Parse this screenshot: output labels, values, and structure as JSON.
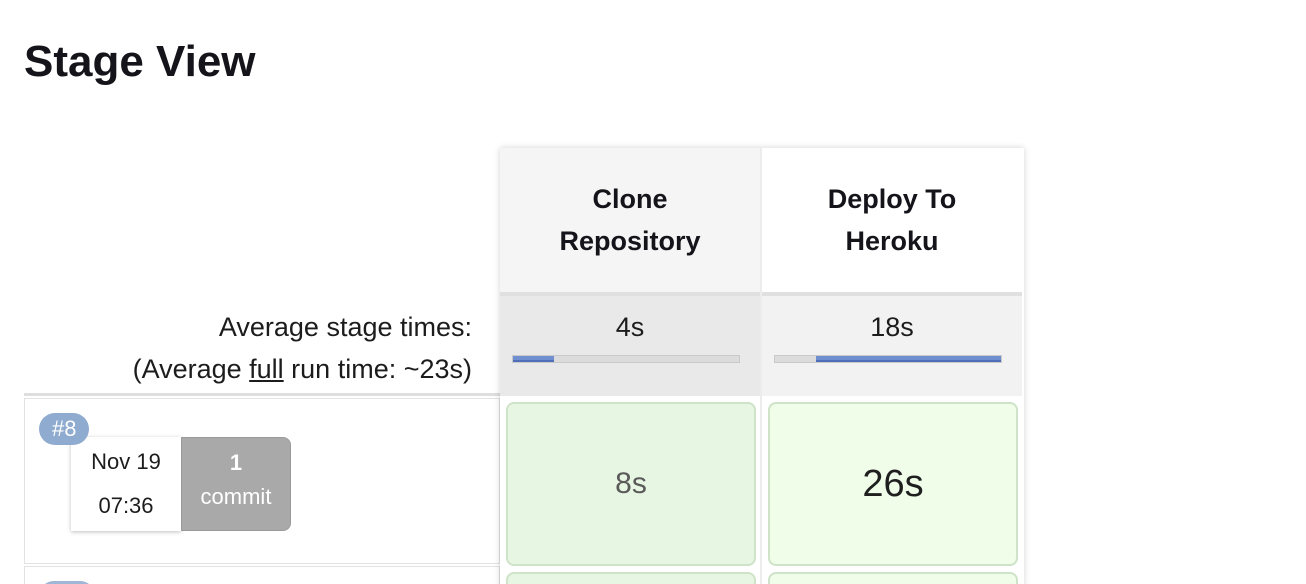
{
  "page": {
    "title": "Stage View"
  },
  "summary": {
    "avg_label": "Average stage times:",
    "avg_full_prefix": "(Average ",
    "avg_full_link": "full",
    "avg_full_suffix": " run time: ~23s)"
  },
  "stages": [
    {
      "name_line1": "Clone",
      "name_line2": "Repository",
      "avg_time": "4s",
      "avg_fraction": 0.18,
      "avg_offset_fraction": 0.0,
      "run_time": "8s"
    },
    {
      "name_line1": "Deploy To",
      "name_line2": "Heroku",
      "avg_time": "18s",
      "avg_fraction": 0.82,
      "avg_offset_fraction": 0.18,
      "run_time": "26s"
    }
  ],
  "runs": [
    {
      "build": "#8",
      "date": "Nov 19",
      "time": "07:36",
      "commit_count": "1",
      "commit_label": "commit"
    }
  ],
  "colors": {
    "success_cell": "#e7f6e2",
    "progress_fill": "#6f8fd0",
    "build_badge": "#8fabd0",
    "commit_box": "#a9a9a9"
  }
}
